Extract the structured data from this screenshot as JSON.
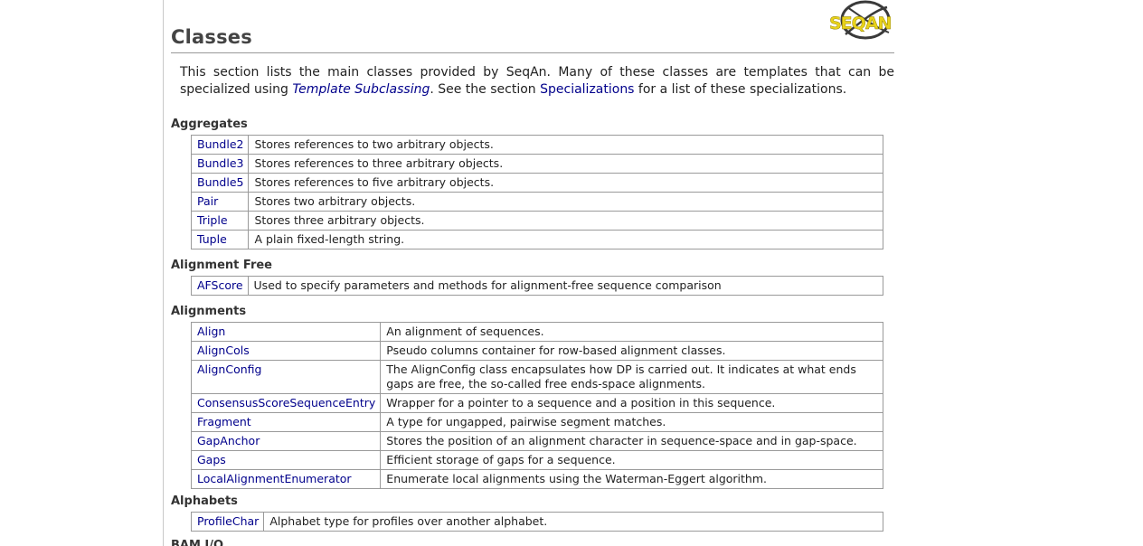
{
  "logo": {
    "text": "SEQAN",
    "colors": {
      "ring": "#3a3a3a",
      "text": "#e8d21a"
    }
  },
  "page": {
    "title": "Classes"
  },
  "intro": {
    "before": "This section lists the main classes provided by SeqAn. Many of these classes are templates that can be specialized using ",
    "link1": "Template Subclassing",
    "middle": ". See the section ",
    "link2": "Specializations",
    "after": " for a list of these specializations."
  },
  "sections": [
    {
      "heading": "Aggregates",
      "rows": [
        {
          "name": "Bundle2",
          "desc": "Stores references to two arbitrary objects."
        },
        {
          "name": "Bundle3",
          "desc": "Stores references to three arbitrary objects."
        },
        {
          "name": "Bundle5",
          "desc": "Stores references to five arbitrary objects."
        },
        {
          "name": "Pair",
          "desc": "Stores two arbitrary objects."
        },
        {
          "name": "Triple",
          "desc": "Stores three arbitrary objects."
        },
        {
          "name": "Tuple",
          "desc": "A plain fixed-length string."
        }
      ]
    },
    {
      "heading": "Alignment Free",
      "rows": [
        {
          "name": "AFScore",
          "desc": "Used to specify parameters and methods for alignment-free sequence comparison"
        }
      ]
    },
    {
      "heading": "Alignments",
      "rows": [
        {
          "name": "Align",
          "desc": "An alignment of sequences."
        },
        {
          "name": "AlignCols",
          "desc": "Pseudo columns container for row-based alignment classes."
        },
        {
          "name": "AlignConfig",
          "desc": "The AlignConfig class encapsulates how DP is carried out. It indicates at what ends gaps are free, the so-called free ends-space alignments."
        },
        {
          "name": "ConsensusScoreSequenceEntry",
          "desc": "Wrapper for a pointer to a sequence and a position in this sequence."
        },
        {
          "name": "Fragment",
          "desc": "A type for ungapped, pairwise segment matches."
        },
        {
          "name": "GapAnchor",
          "desc": "Stores the position of an alignment character in sequence-space and in gap-space."
        },
        {
          "name": "Gaps",
          "desc": "Efficient storage of gaps for a sequence."
        },
        {
          "name": "LocalAlignmentEnumerator",
          "desc": "Enumerate local alignments using the Waterman-Eggert algorithm."
        }
      ]
    },
    {
      "heading": "Alphabets",
      "rows": [
        {
          "name": "ProfileChar",
          "desc": "Alphabet type for profiles over another alphabet."
        }
      ]
    },
    {
      "heading": "BAM I/O",
      "rows": []
    }
  ],
  "colors": {
    "link": "#00008b",
    "heading": "#333333",
    "border": "#9a9a9a"
  }
}
